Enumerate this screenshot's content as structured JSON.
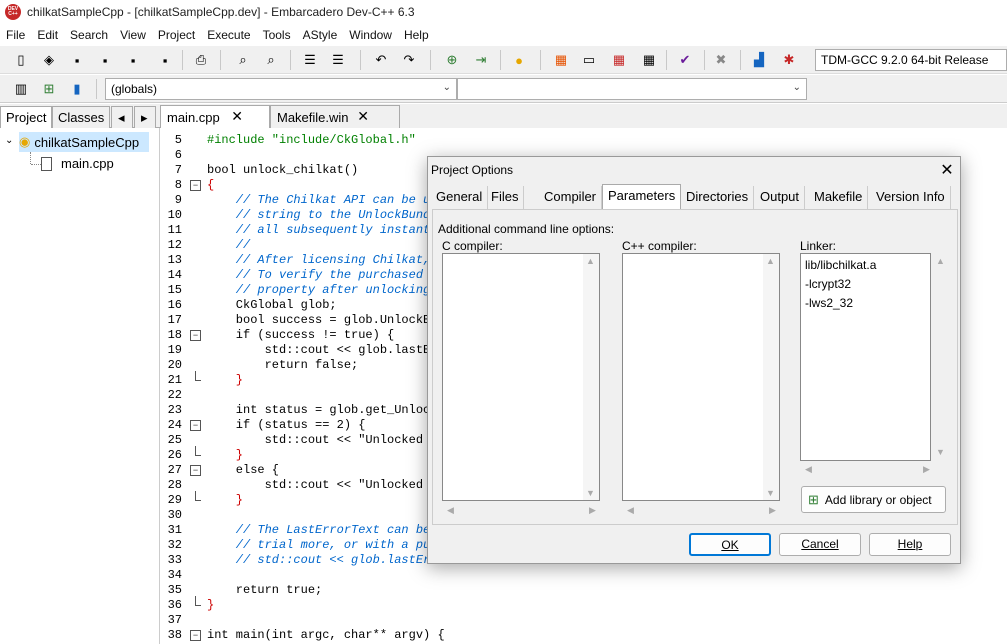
{
  "window": {
    "title": "chilkatSampleCpp - [chilkatSampleCpp.dev] - Embarcadero Dev-C++ 6.3",
    "icon": "devcpp-app-icon"
  },
  "menu": [
    "File",
    "Edit",
    "Search",
    "View",
    "Project",
    "Execute",
    "Tools",
    "AStyle",
    "Window",
    "Help"
  ],
  "toolbar": {
    "compiler": "TDM-GCC 9.2.0 64-bit Release",
    "scope": "(globals)"
  },
  "left_panel": {
    "tabs": [
      "Project",
      "Classes"
    ],
    "tree": {
      "project": "chilkatSampleCpp",
      "file": "main.cpp"
    }
  },
  "editor_tabs": [
    "main.cpp",
    "Makefile.win"
  ],
  "gutter": [
    "5",
    "6",
    "7",
    "8",
    "9",
    "10",
    "11",
    "12",
    "13",
    "14",
    "15",
    "16",
    "17",
    "18",
    "19",
    "20",
    "21",
    "22",
    "23",
    "24",
    "25",
    "26",
    "27",
    "28",
    "29",
    "30",
    "31",
    "32",
    "33",
    "34",
    "35",
    "36",
    "37",
    "38"
  ],
  "code": [
    "#include \"include/CkGlobal.h\"",
    "",
    "bool unlock_chilkat()",
    "{",
    "    // The Chilkat API can be u",
    "    // string to the UnlockBund",
    "    // all subsequently instant",
    "    //",
    "    // After licensing Chilkat,",
    "    // To verify the purchased ",
    "    // property after unlocking",
    "    CkGlobal glob;",
    "    bool success = glob.UnlockBu",
    "    if (success != true) {",
    "        std::cout << glob.lastEr",
    "        return false;",
    "    }",
    "",
    "    int status = glob.get_Unlock",
    "    if (status == 2) {",
    "        std::cout << \"Unlocked u",
    "    }",
    "    else {",
    "        std::cout << \"Unlocked i",
    "    }",
    "",
    "    // The LastErrorText can be",
    "    // trial more, or with a pu",
    "    // std::cout << glob.lastErr",
    "",
    "    return true;",
    "}",
    "",
    "int main(int argc, char** argv) {"
  ],
  "dialog": {
    "title": "Project Options",
    "tabs": [
      "General",
      "Files",
      "Compiler",
      "Parameters",
      "Directories",
      "Output",
      "Makefile",
      "Version Info"
    ],
    "active_tab": "Parameters",
    "heading": "Additional command line options:",
    "c_label": "C compiler:",
    "cpp_label": "C++ compiler:",
    "linker_label": "Linker:",
    "linker_items": [
      "lib/libchilkat.a",
      "-lcrypt32",
      "-lws2_32"
    ],
    "add_library": "Add library or object",
    "ok": "OK",
    "cancel": "Cancel",
    "help": "Help"
  }
}
